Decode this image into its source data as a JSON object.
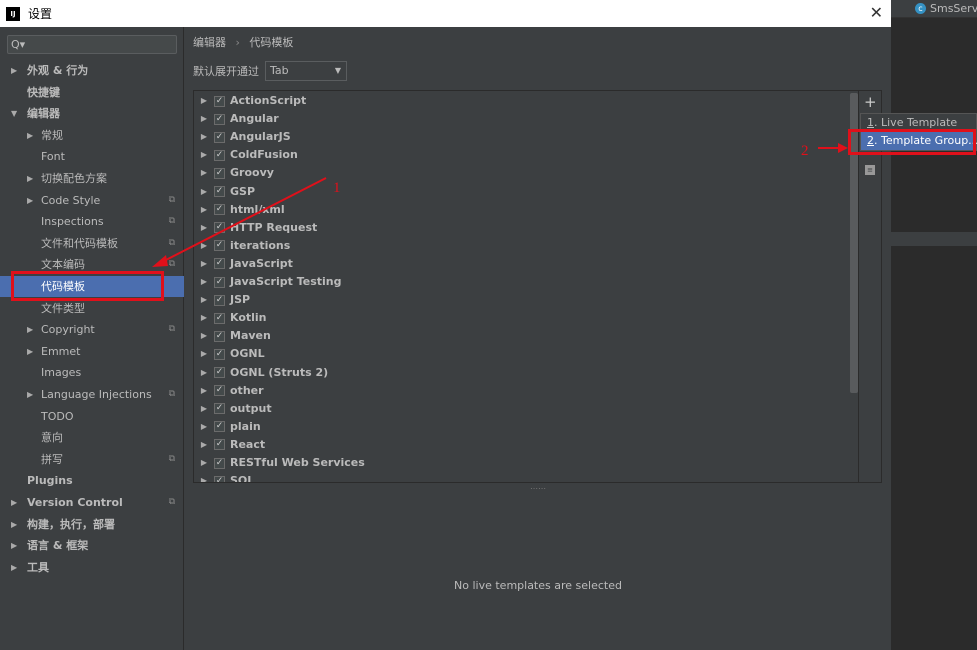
{
  "window": {
    "title": "设置",
    "close_icon": "close-icon"
  },
  "ide_tab": {
    "label": "SmsServic"
  },
  "search": {
    "placeholder": "Q▾"
  },
  "sidebar": {
    "items": [
      {
        "label": "外观 & 行为",
        "arrow": "▶",
        "level": 0,
        "bold": true
      },
      {
        "label": "快捷键",
        "arrow": "",
        "level": 0,
        "bold": true
      },
      {
        "label": "编辑器",
        "arrow": "▼",
        "level": 0,
        "bold": true
      },
      {
        "label": "常规",
        "arrow": "▶",
        "level": 1
      },
      {
        "label": "Font",
        "arrow": "",
        "level": 1
      },
      {
        "label": "切换配色方案",
        "arrow": "▶",
        "level": 1
      },
      {
        "label": "Code Style",
        "arrow": "▶",
        "level": 1,
        "copy": true
      },
      {
        "label": "Inspections",
        "arrow": "",
        "level": 1,
        "copy": true
      },
      {
        "label": "文件和代码模板",
        "arrow": "",
        "level": 1,
        "copy": true
      },
      {
        "label": "文本编码",
        "arrow": "",
        "level": 1,
        "copy": true
      },
      {
        "label": "代码模板",
        "arrow": "",
        "level": 1,
        "selected": true
      },
      {
        "label": "文件类型",
        "arrow": "",
        "level": 1
      },
      {
        "label": "Copyright",
        "arrow": "▶",
        "level": 1,
        "copy": true
      },
      {
        "label": "Emmet",
        "arrow": "▶",
        "level": 1
      },
      {
        "label": "Images",
        "arrow": "",
        "level": 1
      },
      {
        "label": "Language Injections",
        "arrow": "▶",
        "level": 1,
        "copy": true
      },
      {
        "label": "TODO",
        "arrow": "",
        "level": 1
      },
      {
        "label": "意向",
        "arrow": "",
        "level": 1
      },
      {
        "label": "拼写",
        "arrow": "",
        "level": 1,
        "copy": true
      },
      {
        "label": "Plugins",
        "arrow": "",
        "level": 0,
        "bold": true
      },
      {
        "label": "Version Control",
        "arrow": "▶",
        "level": 0,
        "bold": true,
        "copy": true
      },
      {
        "label": "构建，执行，部署",
        "arrow": "▶",
        "level": 0,
        "bold": true
      },
      {
        "label": "语言 & 框架",
        "arrow": "▶",
        "level": 0,
        "bold": true
      },
      {
        "label": "工具",
        "arrow": "▶",
        "level": 0,
        "bold": true
      }
    ]
  },
  "breadcrumb": {
    "parent": "编辑器",
    "sep": "›",
    "current": "代码模板"
  },
  "expand": {
    "label": "默认展开通过",
    "value": "Tab"
  },
  "template_groups": [
    "ActionScript",
    "Angular",
    "AngularJS",
    "ColdFusion",
    "Groovy",
    "GSP",
    "html/xml",
    "HTTP Request",
    "iterations",
    "JavaScript",
    "JavaScript Testing",
    "JSP",
    "Kotlin",
    "Maven",
    "OGNL",
    "OGNL (Struts 2)",
    "other",
    "output",
    "plain",
    "React",
    "RESTful Web Services",
    "SQL"
  ],
  "toolbar": {
    "add": "+"
  },
  "popup": {
    "items": [
      {
        "num": "1",
        "label": ". Live Template"
      },
      {
        "num": "2",
        "label": ". Template Group..."
      }
    ]
  },
  "empty_message": "No live templates are selected",
  "annotations": {
    "one": "1",
    "two": "2",
    "color": "#e0101a"
  },
  "colors": {
    "selection": "#4b6eaf",
    "background": "#3c3f41"
  }
}
